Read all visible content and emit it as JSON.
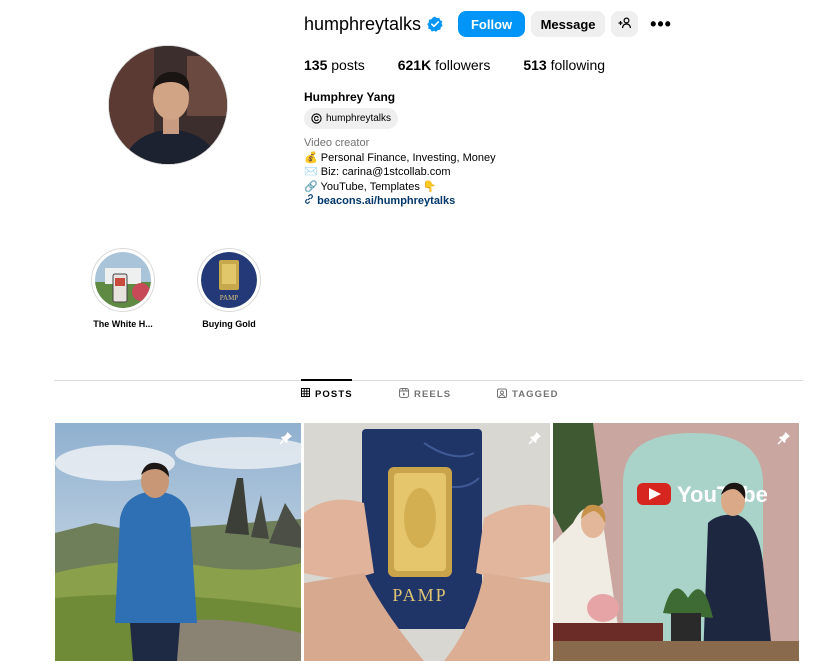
{
  "profile": {
    "username": "humphreytalks",
    "follow_label": "Follow",
    "message_label": "Message",
    "stats": {
      "posts_count": "135",
      "posts_label": "posts",
      "followers_count": "621K",
      "followers_label": "followers",
      "following_count": "513",
      "following_label": "following"
    },
    "full_name": "Humphrey Yang",
    "threads_handle": "humphreytalks",
    "bio": {
      "category": "Video creator",
      "line1": "💰 Personal Finance, Investing, Money",
      "line2": "✉️ Biz: carina@1stcollab.com",
      "line3": "🔗 YouTube, Templates 👇",
      "link": "beacons.ai/humphreytalks"
    }
  },
  "highlights": [
    {
      "label": "The White H..."
    },
    {
      "label": "Buying Gold"
    }
  ],
  "tabs": [
    {
      "label": "POSTS",
      "icon": "grid-icon",
      "active": true
    },
    {
      "label": "REELS",
      "icon": "reels-icon",
      "active": false
    },
    {
      "label": "TAGGED",
      "icon": "tagged-icon",
      "active": false
    }
  ],
  "posts": [
    {
      "subject": "hiker-mountain",
      "pinned": true
    },
    {
      "subject": "gold-bar",
      "pinned": true,
      "text": "PAMP"
    },
    {
      "subject": "youtube-interview",
      "pinned": true,
      "text": "YouTube"
    }
  ],
  "colors": {
    "primary_blue": "#0095f6",
    "link_navy": "#00376b",
    "secondary_gray": "#737373",
    "button_gray": "#efefef"
  }
}
